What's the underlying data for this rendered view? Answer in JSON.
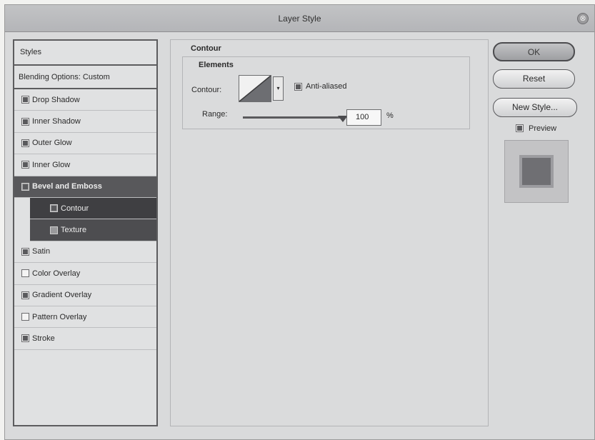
{
  "window": {
    "title": "Layer Style",
    "close_glyph": "⊗"
  },
  "styles_panel": {
    "header": "Styles",
    "blending": "Blending Options: Custom",
    "items": [
      {
        "label": "Drop Shadow",
        "checked": true
      },
      {
        "label": "Inner Shadow",
        "checked": true
      },
      {
        "label": "Outer Glow",
        "checked": true
      },
      {
        "label": "Inner Glow",
        "checked": true
      },
      {
        "label": "Bevel and Emboss",
        "checked": true,
        "selected": true
      },
      {
        "label": "Contour",
        "checked": true,
        "sub": true
      },
      {
        "label": "Texture",
        "checked": false,
        "sub": true
      },
      {
        "label": "Satin",
        "checked": true
      },
      {
        "label": "Color Overlay",
        "checked": false
      },
      {
        "label": "Gradient Overlay",
        "checked": true
      },
      {
        "label": "Pattern Overlay",
        "checked": false
      },
      {
        "label": "Stroke",
        "checked": true
      }
    ]
  },
  "contour": {
    "group_title": "Contour",
    "elements_title": "Elements",
    "contour_label": "Contour:",
    "dropdown_glyph": "▾",
    "anti_aliased_label": "Anti-aliased",
    "anti_aliased": true,
    "range_label": "Range:",
    "range_value": "100",
    "range_unit": "%"
  },
  "buttons": {
    "ok": "OK",
    "reset": "Reset",
    "new_style": "New Style...",
    "preview_label": "Preview",
    "preview_checked": true
  }
}
